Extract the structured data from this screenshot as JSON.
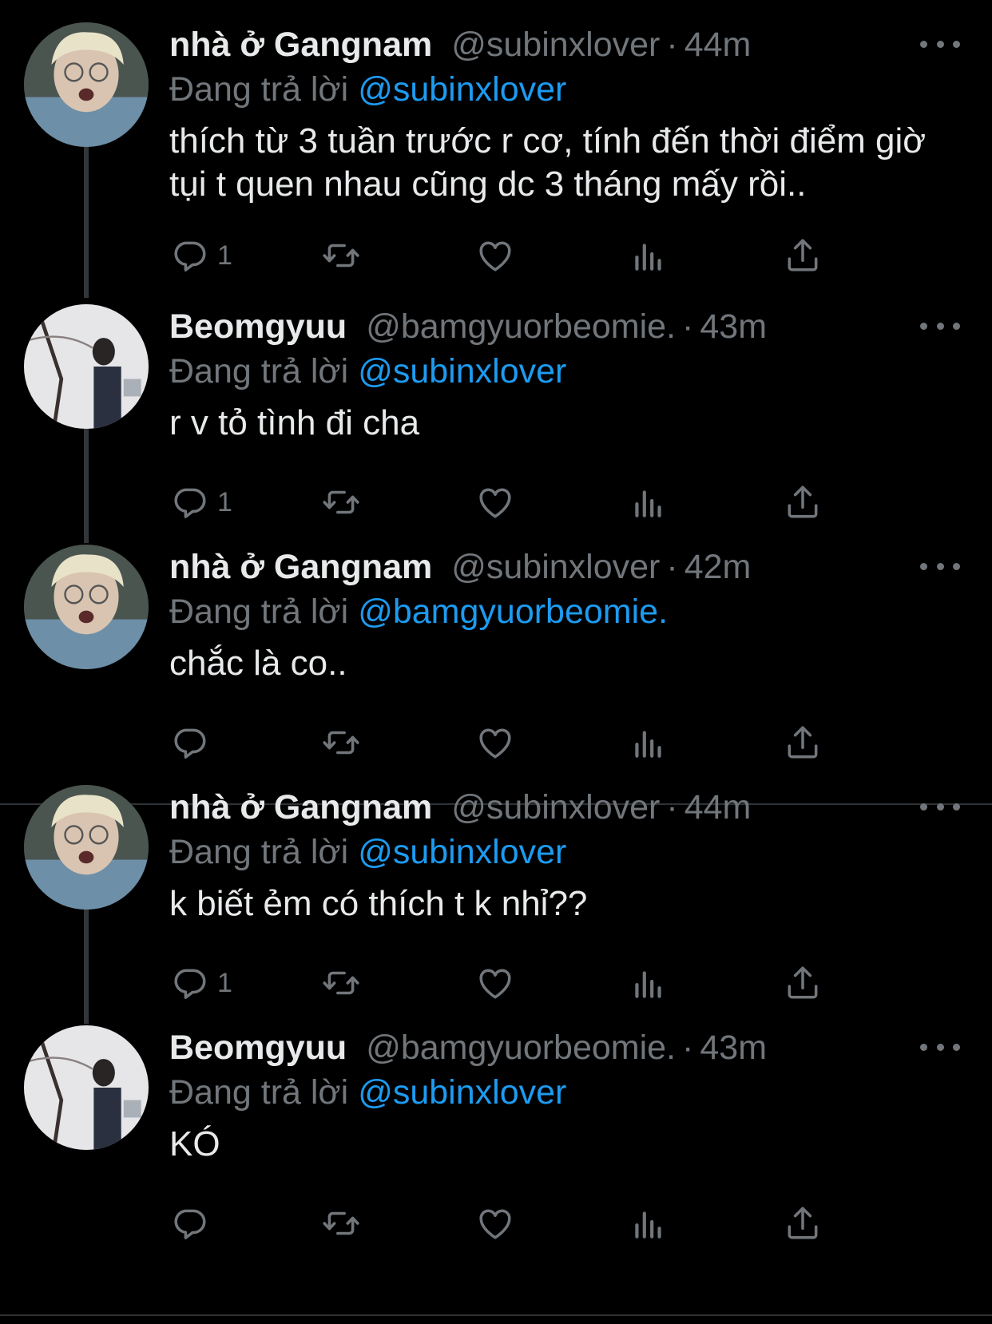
{
  "colors": {
    "background": "#000000",
    "text_primary": "#e7e9ea",
    "text_secondary": "#71767b",
    "mention": "#1d9bf0",
    "thread_line": "#333639"
  },
  "icons": {
    "reply": "reply-icon",
    "retweet": "retweet-icon",
    "like": "heart-icon",
    "views": "analytics-icon",
    "share": "share-icon",
    "more": "more-icon"
  },
  "tweets": [
    {
      "display_name": "nhà ở Gangnam",
      "handle": "@subinxlover",
      "separator": "·",
      "time": "44m",
      "reply_prefix": "Đang trả lời",
      "reply_to": "@subinxlover",
      "text": "thích từ 3 tuần trước r cơ, tính đến thời điểm giờ tụi t quen nhau cũng dc 3 tháng mấy rồi..",
      "reply_count": "1"
    },
    {
      "display_name": "Beomgyuu",
      "handle": "@bamgyuorbeomie.",
      "separator": "·",
      "time": "43m",
      "reply_prefix": "Đang trả lời",
      "reply_to": "@subinxlover",
      "text": "r v tỏ tình đi cha",
      "reply_count": "1"
    },
    {
      "display_name": "nhà ở Gangnam",
      "handle": "@subinxlover",
      "separator": "·",
      "time": "42m",
      "reply_prefix": "Đang trả lời",
      "reply_to": "@bamgyuorbeomie.",
      "text": "chắc là co..",
      "reply_count": ""
    },
    {
      "display_name": "nhà ở Gangnam",
      "handle": "@subinxlover",
      "separator": "·",
      "time": "44m",
      "reply_prefix": "Đang trả lời",
      "reply_to": "@subinxlover",
      "text": "k biết ẻm có thích t k nhỉ??",
      "reply_count": "1"
    },
    {
      "display_name": "Beomgyuu",
      "handle": "@bamgyuorbeomie.",
      "separator": "·",
      "time": "43m",
      "reply_prefix": "Đang trả lời",
      "reply_to": "@subinxlover",
      "text": "KÓ",
      "reply_count": ""
    }
  ]
}
